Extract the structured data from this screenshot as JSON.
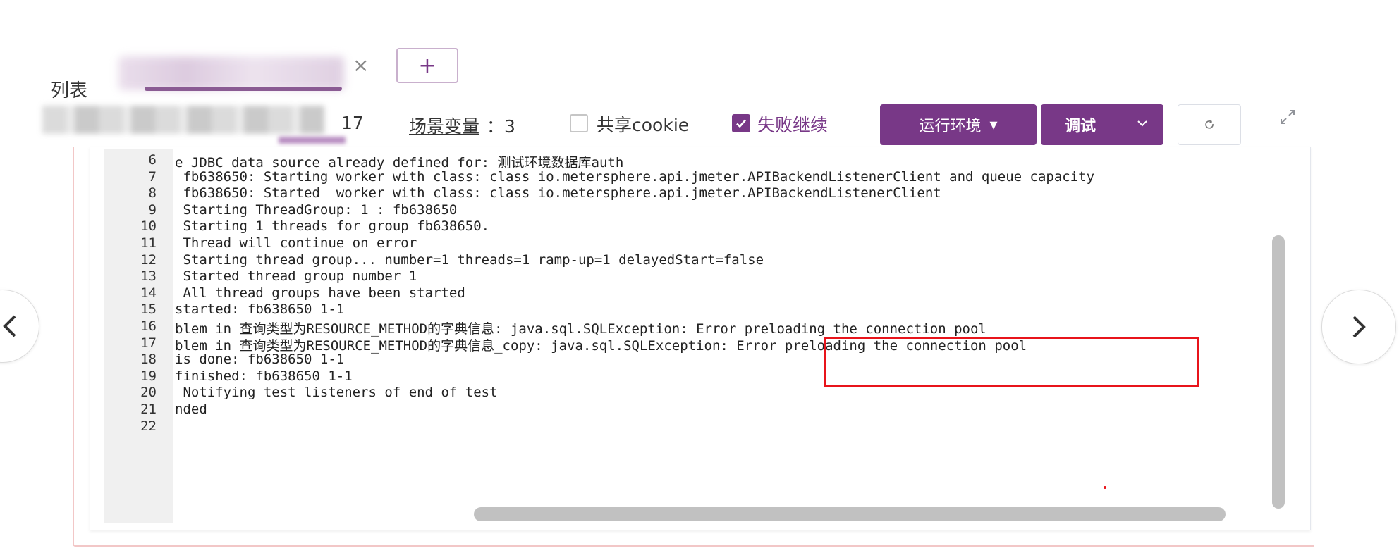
{
  "tab_bar": {
    "list_label": "列表",
    "close_symbol": "×",
    "add_symbol": "+"
  },
  "toolbar": {
    "step_count": "17",
    "scenario_vars_label": "场景变量",
    "scenario_vars_count": "：3",
    "share_cookie_label": "共享cookie",
    "share_cookie_checked": false,
    "fail_continue_label": "失败继续",
    "fail_continue_checked": true,
    "env_button_label": "运行环境",
    "env_caret": "▾",
    "debug_button_label": "调试",
    "debug_caret": "⌵",
    "refresh_icon": "refresh-icon",
    "expand_icon": "expand-icon"
  },
  "log": {
    "top_partial": "··· ·· ·· ·· ···",
    "lines": [
      {
        "num": "6",
        "text": "e JDBC data source already defined for: 测试环境数据库auth"
      },
      {
        "num": "7",
        "text": " fb638650: Starting worker with class: class io.metersphere.api.jmeter.APIBackendListenerClient and queue capacity"
      },
      {
        "num": "8",
        "text": " fb638650: Started  worker with class: class io.metersphere.api.jmeter.APIBackendListenerClient"
      },
      {
        "num": "9",
        "text": " Starting ThreadGroup: 1 : fb638650"
      },
      {
        "num": "10",
        "text": " Starting 1 threads for group fb638650."
      },
      {
        "num": "11",
        "text": " Thread will continue on error"
      },
      {
        "num": "12",
        "text": " Starting thread group... number=1 threads=1 ramp-up=1 delayedStart=false"
      },
      {
        "num": "13",
        "text": " Started thread group number 1"
      },
      {
        "num": "14",
        "text": " All thread groups have been started"
      },
      {
        "num": "15",
        "text": "started: fb638650 1-1"
      },
      {
        "num": "16",
        "text": "blem in 查询类型为RESOURCE_METHOD的字典信息: java.sql.SQLException: Error preloading the connection pool"
      },
      {
        "num": "17",
        "text": "blem in 查询类型为RESOURCE_METHOD的字典信息_copy: java.sql.SQLException: Error preloading the connection pool"
      },
      {
        "num": "18",
        "text": "is done: fb638650 1-1"
      },
      {
        "num": "19",
        "text": "finished: fb638650 1-1"
      },
      {
        "num": "20",
        "text": " Notifying test listeners of end of test"
      },
      {
        "num": "21",
        "text": "nded"
      },
      {
        "num": "22",
        "text": ""
      }
    ]
  },
  "nav": {
    "prev_symbol": "‹",
    "next_symbol": "›"
  },
  "colors": {
    "primary": "#783887",
    "highlight_border": "#e8141b"
  }
}
